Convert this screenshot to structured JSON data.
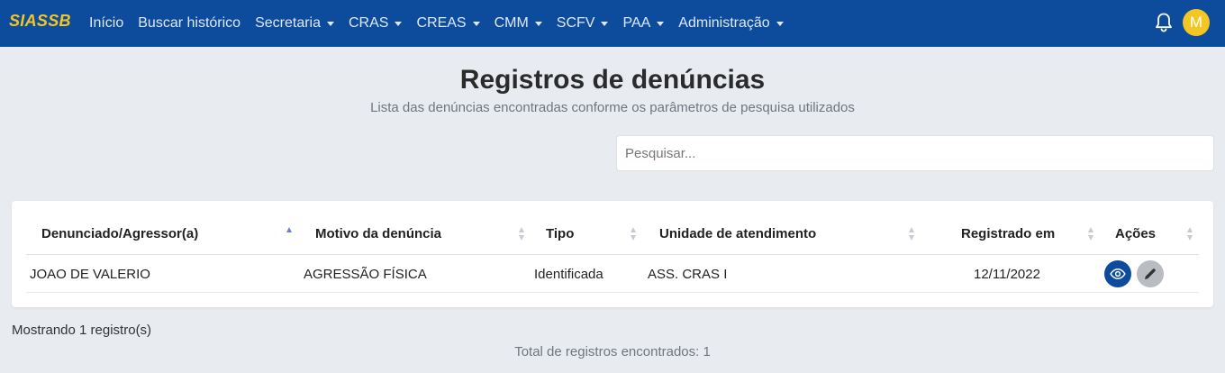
{
  "navbar": {
    "brand": "SIASSB",
    "items": [
      {
        "label": "Início",
        "dropdown": false
      },
      {
        "label": "Buscar histórico",
        "dropdown": false
      },
      {
        "label": "Secretaria",
        "dropdown": true
      },
      {
        "label": "CRAS",
        "dropdown": true
      },
      {
        "label": "CREAS",
        "dropdown": true
      },
      {
        "label": "CMM",
        "dropdown": true
      },
      {
        "label": "SCFV",
        "dropdown": true
      },
      {
        "label": "PAA",
        "dropdown": true
      },
      {
        "label": "Administração",
        "dropdown": true
      }
    ],
    "avatar_initial": "M",
    "bell_icon": "bell-icon",
    "colors": {
      "bar": "#0d4c9c",
      "brand": "#f3c623",
      "avatar": "#f3c623"
    }
  },
  "page": {
    "title": "Registros de denúncias",
    "subtitle": "Lista das denúncias encontradas conforme os parâmetros de pesquisa utilizados"
  },
  "search": {
    "placeholder": "Pesquisar...",
    "value": ""
  },
  "table": {
    "columns": [
      {
        "label": "Denunciado/Agressor(a)",
        "sorted": "asc"
      },
      {
        "label": "Motivo da denúncia",
        "sorted": "none"
      },
      {
        "label": "Tipo",
        "sorted": "none"
      },
      {
        "label": "Unidade de atendimento",
        "sorted": "none"
      },
      {
        "label": "Registrado em",
        "sorted": "none"
      },
      {
        "label": "Ações",
        "sorted": "none"
      }
    ],
    "rows": [
      {
        "denunciado": "JOAO DE VALERIO",
        "motivo": "AGRESSÃO FÍSICA",
        "tipo": "Identificada",
        "unidade": "ASS. CRAS I",
        "registrado_em": "12/11/2022",
        "actions": [
          "eye-icon",
          "pencil-icon"
        ]
      }
    ]
  },
  "footer": {
    "showing": "Mostrando 1 registro(s)",
    "total": "Total de registros encontrados: 1"
  }
}
